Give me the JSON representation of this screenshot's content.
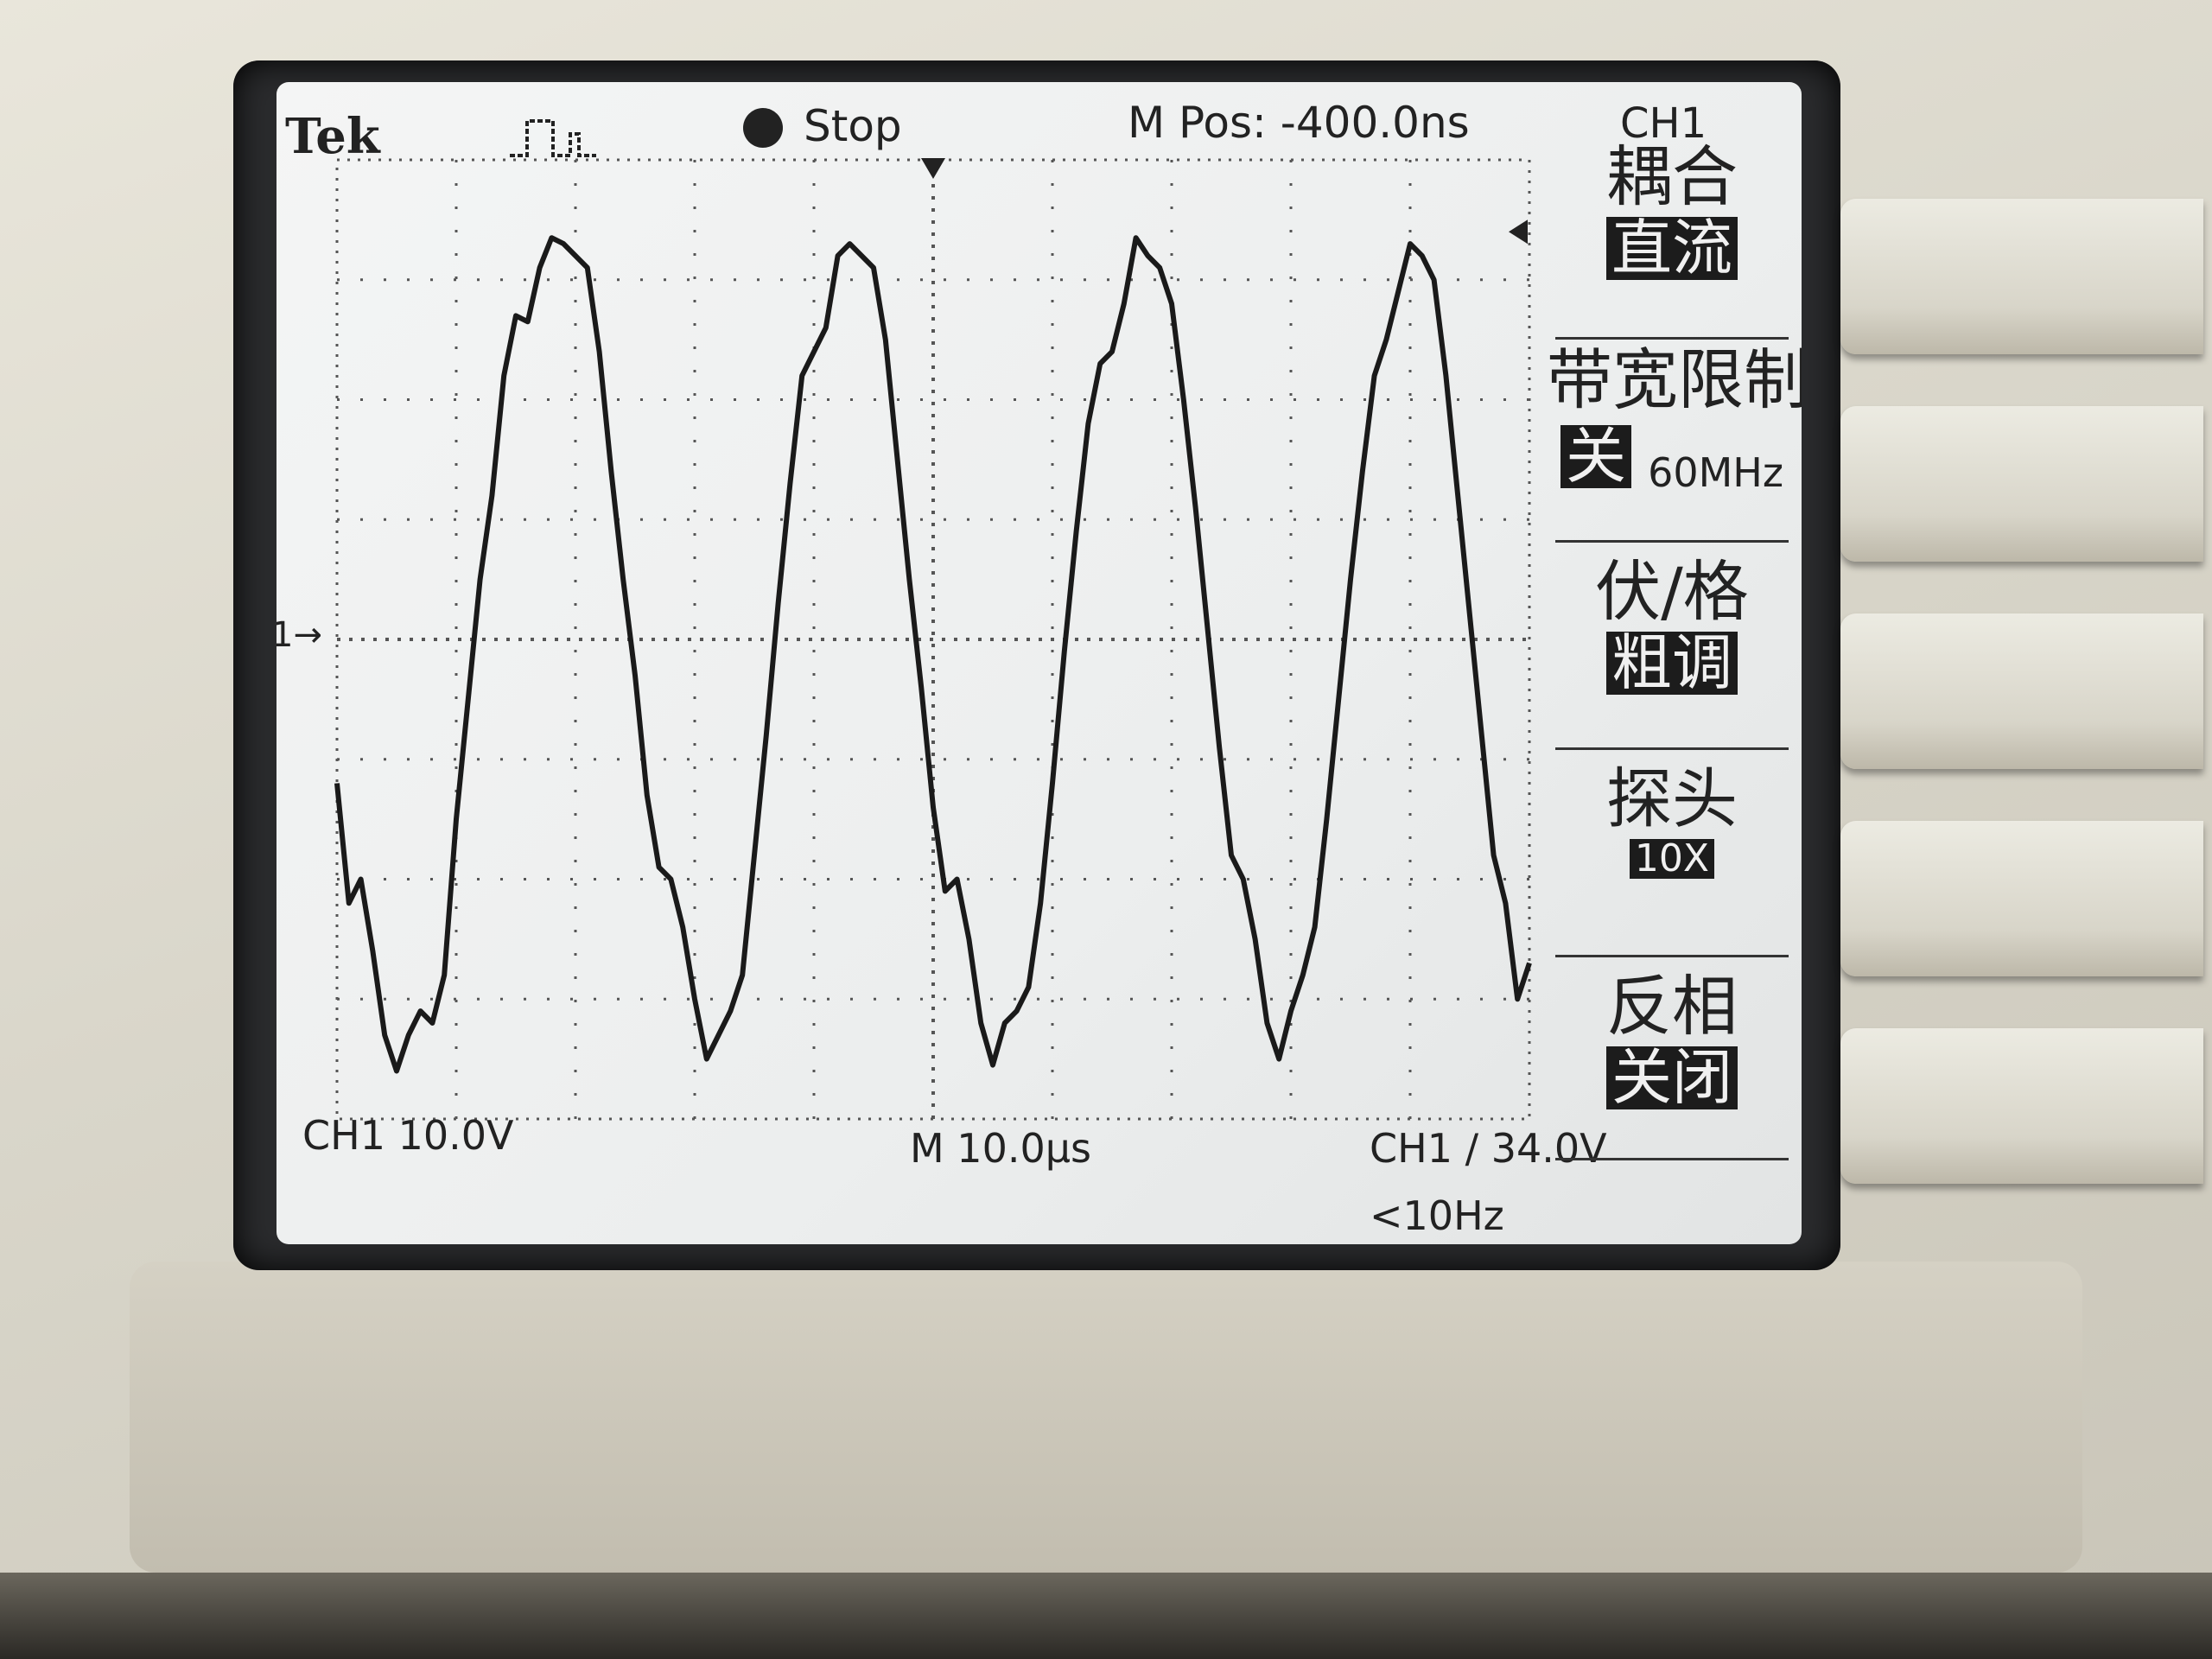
{
  "header": {
    "brand": "Tek",
    "status": "Stop",
    "m_pos": "M Pos: -400.0ns",
    "channel": "CH1"
  },
  "footer": {
    "ch1_scale": "CH1  10.0V",
    "timebase": "M 10.0µs",
    "trigger": "CH1 ∕ 34.0V",
    "trigger_freq": "<10Hz"
  },
  "markers": {
    "ch1_ground": "1→"
  },
  "menu": {
    "coupling": {
      "title": "耦合",
      "value": "直流"
    },
    "bandwidth": {
      "title": "带宽限制",
      "value": "关",
      "extra": "60MHz"
    },
    "volts_div": {
      "title": "伏/格",
      "value": "粗调"
    },
    "probe": {
      "title": "探头",
      "value": "10X"
    },
    "invert": {
      "title": "反相",
      "value": "关闭"
    }
  },
  "colors": {
    "trace": "#1a1a1a",
    "screen_bg": "#eeefef",
    "grid": "#555555"
  },
  "chart_data": {
    "type": "line",
    "grid": {
      "horizontal_divisions": 10,
      "vertical_divisions": 8,
      "dotted": true
    },
    "xlim": [
      -50,
      50
    ],
    "ylim": [
      -40,
      40
    ],
    "x_unit": "us",
    "y_unit": "V",
    "series": [
      {
        "points": [
          [
            -50,
            -12.0
          ],
          [
            -49,
            -22.0
          ],
          [
            -48,
            -20.0
          ],
          [
            -47,
            -26.0
          ],
          [
            -46,
            -33.0
          ],
          [
            -45,
            -36.0
          ],
          [
            -44,
            -33.0
          ],
          [
            -43,
            -31.0
          ],
          [
            -42,
            -32.0
          ],
          [
            -41,
            -28.0
          ],
          [
            -40,
            -15.0
          ],
          [
            -39,
            -5.0
          ],
          [
            -38,
            5.0
          ],
          [
            -37,
            12.0
          ],
          [
            -36,
            22.0
          ],
          [
            -35,
            27.0
          ],
          [
            -34,
            26.5
          ],
          [
            -33,
            31.0
          ],
          [
            -32,
            33.5
          ],
          [
            -31,
            33.0
          ],
          [
            -30,
            32.0
          ],
          [
            -29,
            31.0
          ],
          [
            -28,
            24.0
          ],
          [
            -27,
            14.0
          ],
          [
            -26,
            5.0
          ],
          [
            -25,
            -3.0
          ],
          [
            -24,
            -13.0
          ],
          [
            -23,
            -19.0
          ],
          [
            -22,
            -20.0
          ],
          [
            -21,
            -24.0
          ],
          [
            -20,
            -30.0
          ],
          [
            -19,
            -35.0
          ],
          [
            -18,
            -33.0
          ],
          [
            -17,
            -31.0
          ],
          [
            -16,
            -28.0
          ],
          [
            -15,
            -18.0
          ],
          [
            -14,
            -8.0
          ],
          [
            -13,
            3.0
          ],
          [
            -12,
            13.0
          ],
          [
            -11,
            22.0
          ],
          [
            -10,
            24.0
          ],
          [
            -9,
            26.0
          ],
          [
            -8,
            32.0
          ],
          [
            -7,
            33.0
          ],
          [
            -6,
            32.0
          ],
          [
            -5,
            31.0
          ],
          [
            -4,
            25.0
          ],
          [
            -3,
            15.0
          ],
          [
            -2,
            5.0
          ],
          [
            -1,
            -4.0
          ],
          [
            0,
            -14.0
          ],
          [
            1,
            -21.0
          ],
          [
            2,
            -20.0
          ],
          [
            3,
            -25.0
          ],
          [
            4,
            -32.0
          ],
          [
            5,
            -35.5
          ],
          [
            6,
            -32.0
          ],
          [
            7,
            -31.0
          ],
          [
            8,
            -29.0
          ],
          [
            9,
            -22.0
          ],
          [
            10,
            -12.0
          ],
          [
            11,
            -1.0
          ],
          [
            12,
            9.0
          ],
          [
            13,
            18.0
          ],
          [
            14,
            23.0
          ],
          [
            15,
            24.0
          ],
          [
            16,
            28.0
          ],
          [
            17,
            33.5
          ],
          [
            18,
            32.0
          ],
          [
            19,
            31.0
          ],
          [
            20,
            28.0
          ],
          [
            21,
            20.0
          ],
          [
            22,
            11.0
          ],
          [
            23,
            1.0
          ],
          [
            24,
            -9.0
          ],
          [
            25,
            -18.0
          ],
          [
            26,
            -20.0
          ],
          [
            27,
            -25.0
          ],
          [
            28,
            -32.0
          ],
          [
            29,
            -35.0
          ],
          [
            30,
            -31.0
          ],
          [
            31,
            -28.0
          ],
          [
            32,
            -24.0
          ],
          [
            33,
            -15.0
          ],
          [
            34,
            -5.0
          ],
          [
            35,
            5.0
          ],
          [
            36,
            14.0
          ],
          [
            37,
            22.0
          ],
          [
            38,
            25.0
          ],
          [
            39,
            29.0
          ],
          [
            40,
            33.0
          ],
          [
            41,
            32.0
          ],
          [
            42,
            30.0
          ],
          [
            43,
            22.0
          ],
          [
            44,
            12.0
          ],
          [
            45,
            2.0
          ],
          [
            46,
            -8.0
          ],
          [
            47,
            -18.0
          ],
          [
            48,
            -22.0
          ],
          [
            49,
            -30.0
          ],
          [
            50,
            -27.0
          ]
        ]
      }
    ]
  }
}
